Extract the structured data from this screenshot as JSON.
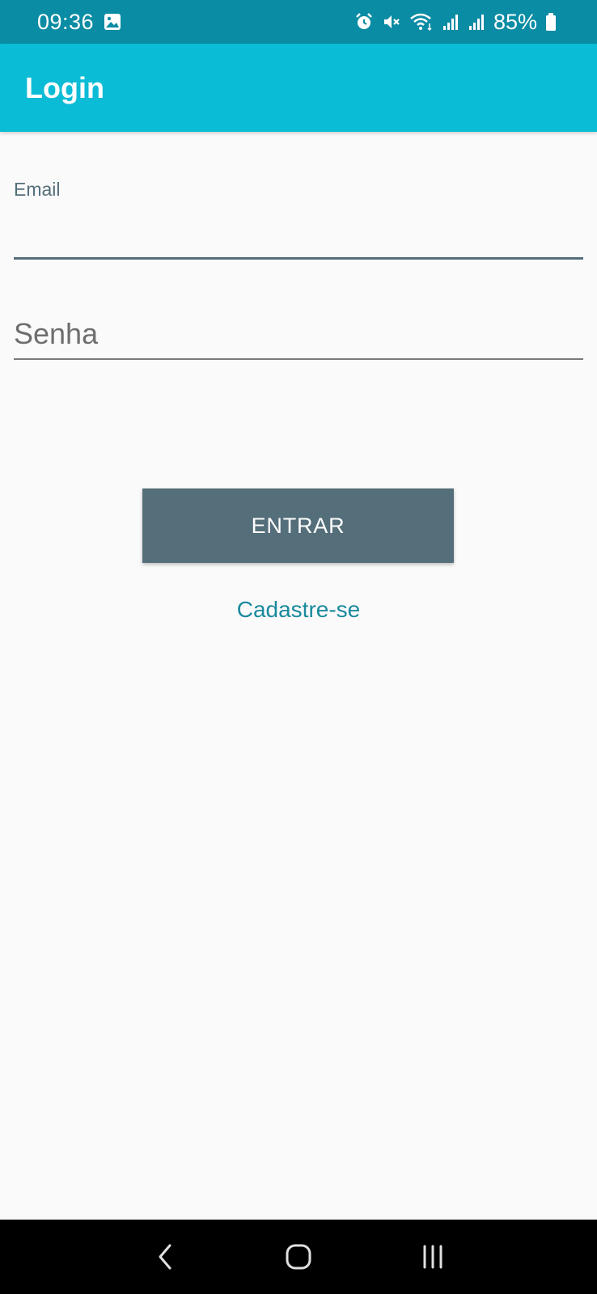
{
  "status_bar": {
    "time": "09:36",
    "battery": "85%",
    "icons": [
      "image-icon",
      "alarm-icon",
      "mute-icon",
      "wifi-icon",
      "signal-icon",
      "signal-icon",
      "battery-icon"
    ]
  },
  "app_bar": {
    "title": "Login"
  },
  "form": {
    "email_label": "Email",
    "email_value": "",
    "password_placeholder": "Senha",
    "password_value": "",
    "login_button": "ENTRAR",
    "signup_link": "Cadastre-se"
  },
  "nav_bar": {
    "icons": [
      "back-icon",
      "home-icon",
      "recents-icon"
    ]
  },
  "colors": {
    "status_bar": "#0a8ca4",
    "app_bar": "#0bbcd6",
    "button": "#546e7a",
    "link": "#1a8a9e",
    "background": "#fafafa"
  }
}
